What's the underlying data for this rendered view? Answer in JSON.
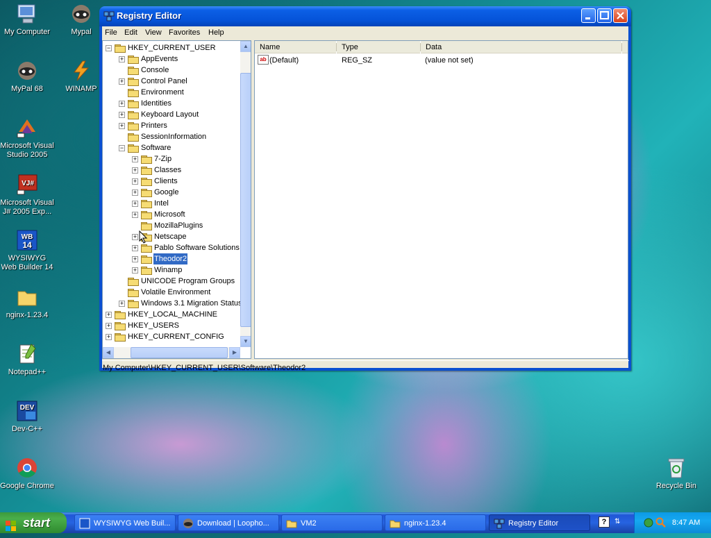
{
  "desktop": {
    "icons": [
      {
        "label": "My Computer"
      },
      {
        "label": "Mypal"
      },
      {
        "label": "MyPal 68"
      },
      {
        "label": "WINAMP"
      },
      {
        "label": "Microsoft Visual Studio 2005"
      },
      {
        "label": "Microsoft Visual J# 2005 Exp..."
      },
      {
        "label": "WYSIWYG Web Builder 14"
      },
      {
        "label": "nginx-1.23.4"
      },
      {
        "label": "Notepad++"
      },
      {
        "label": "Dev-C++"
      },
      {
        "label": "Google Chrome"
      },
      {
        "label": "Recycle Bin"
      }
    ],
    "badges": {
      "wysiwyg": "WB\n14",
      "devcpp": "DEV",
      "vjsharp": "VJ#"
    }
  },
  "window": {
    "title": "Registry Editor",
    "menu": [
      "File",
      "Edit",
      "View",
      "Favorites",
      "Help"
    ],
    "tree": [
      {
        "label": "HKEY_CURRENT_USER",
        "expander": "−"
      },
      {
        "label": "AppEvents",
        "expander": "+"
      },
      {
        "label": "Console",
        "expander": ""
      },
      {
        "label": "Control Panel",
        "expander": "+"
      },
      {
        "label": "Environment",
        "expander": ""
      },
      {
        "label": "Identities",
        "expander": "+"
      },
      {
        "label": "Keyboard Layout",
        "expander": "+"
      },
      {
        "label": "Printers",
        "expander": "+"
      },
      {
        "label": "SessionInformation",
        "expander": ""
      },
      {
        "label": "Software",
        "expander": "−"
      },
      {
        "label": "7-Zip",
        "expander": "+"
      },
      {
        "label": "Classes",
        "expander": "+"
      },
      {
        "label": "Clients",
        "expander": "+"
      },
      {
        "label": "Google",
        "expander": "+"
      },
      {
        "label": "Intel",
        "expander": "+"
      },
      {
        "label": "Microsoft",
        "expander": "+"
      },
      {
        "label": "MozillaPlugins",
        "expander": ""
      },
      {
        "label": "Netscape",
        "expander": "+"
      },
      {
        "label": "Pablo Software Solutions",
        "expander": "+"
      },
      {
        "label": "Theodor2",
        "expander": "+",
        "selected": true
      },
      {
        "label": "Winamp",
        "expander": "+"
      },
      {
        "label": "UNICODE Program Groups",
        "expander": ""
      },
      {
        "label": "Volatile Environment",
        "expander": ""
      },
      {
        "label": "Windows 3.1 Migration Status",
        "expander": "+"
      },
      {
        "label": "HKEY_LOCAL_MACHINE",
        "expander": "+"
      },
      {
        "label": "HKEY_USERS",
        "expander": "+"
      },
      {
        "label": "HKEY_CURRENT_CONFIG",
        "expander": "+"
      }
    ],
    "list": {
      "columns": [
        "Name",
        "Type",
        "Data"
      ],
      "rows": [
        {
          "icon": "ab",
          "name": "(Default)",
          "type": "REG_SZ",
          "data": "(value not set)"
        }
      ]
    },
    "status": "My Computer\\HKEY_CURRENT_USER\\Software\\Theodor2"
  },
  "taskbar": {
    "start_label": "start",
    "tasks": [
      {
        "label": "WYSIWYG Web Buil..."
      },
      {
        "label": "Download | Loopho..."
      },
      {
        "label": "VM2"
      },
      {
        "label": "nginx-1.23.4"
      },
      {
        "label": "Registry Editor",
        "active": true
      }
    ],
    "clock": "8:47 AM"
  },
  "colors": {
    "selection": "#316ac5",
    "titlebar": "#0553d8",
    "start": "#3c9a3c"
  }
}
